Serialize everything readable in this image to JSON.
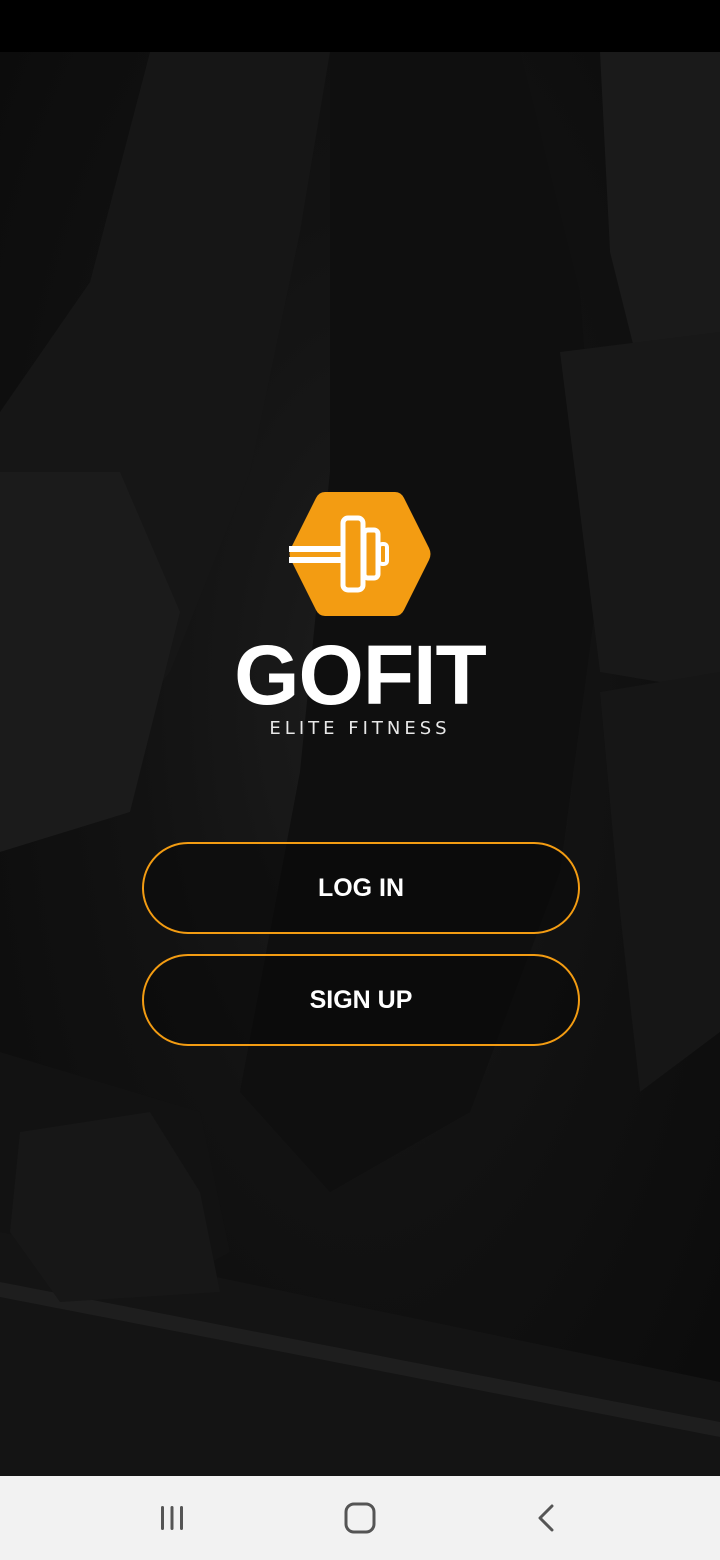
{
  "app": {
    "name": "GOFIT",
    "tagline": "ELITE FITNESS",
    "accent_color": "#f39c12",
    "logo_icon": "barbell-hexagon-icon"
  },
  "actions": {
    "login_label": "LOG IN",
    "signup_label": "SIGN UP"
  },
  "system_nav": {
    "recents_icon": "recents-icon",
    "home_icon": "home-icon",
    "back_icon": "back-icon"
  }
}
